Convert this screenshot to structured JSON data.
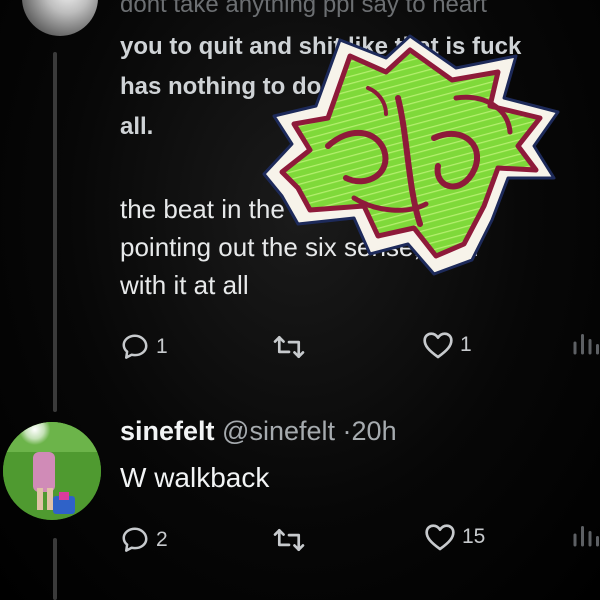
{
  "post": {
    "lines_top": [
      "dont take anything ppl say to heart",
      "you to quit and shit like that is fuck",
      "has nothing to do with my po",
      "all."
    ],
    "lines_bottom": [
      "the beat in the video... but",
      "pointing out the six sense, noth",
      "with it at all"
    ],
    "actions": {
      "reply_count": "1",
      "repost_count": "",
      "like_count": "1"
    }
  },
  "reply": {
    "display_name": "sinefelt",
    "handle": "@sinefelt",
    "separator": "·",
    "time": "20h",
    "text": "W walkback",
    "actions": {
      "reply_count": "2",
      "repost_count": "",
      "like_count": "15"
    }
  },
  "icons": {
    "reply": "speech-bubble-icon",
    "repost": "repost-arrows-icon",
    "like": "heart-icon",
    "views": "bar-chart-icon"
  },
  "colors": {
    "background": "#000000",
    "text": "#e7e9ea",
    "muted": "#a6abaf",
    "thread_line": "#3a3a3a",
    "sticker_green": "#7ad63a",
    "sticker_outline": "#9a1b3a",
    "sticker_border": "#1d2a5a"
  }
}
